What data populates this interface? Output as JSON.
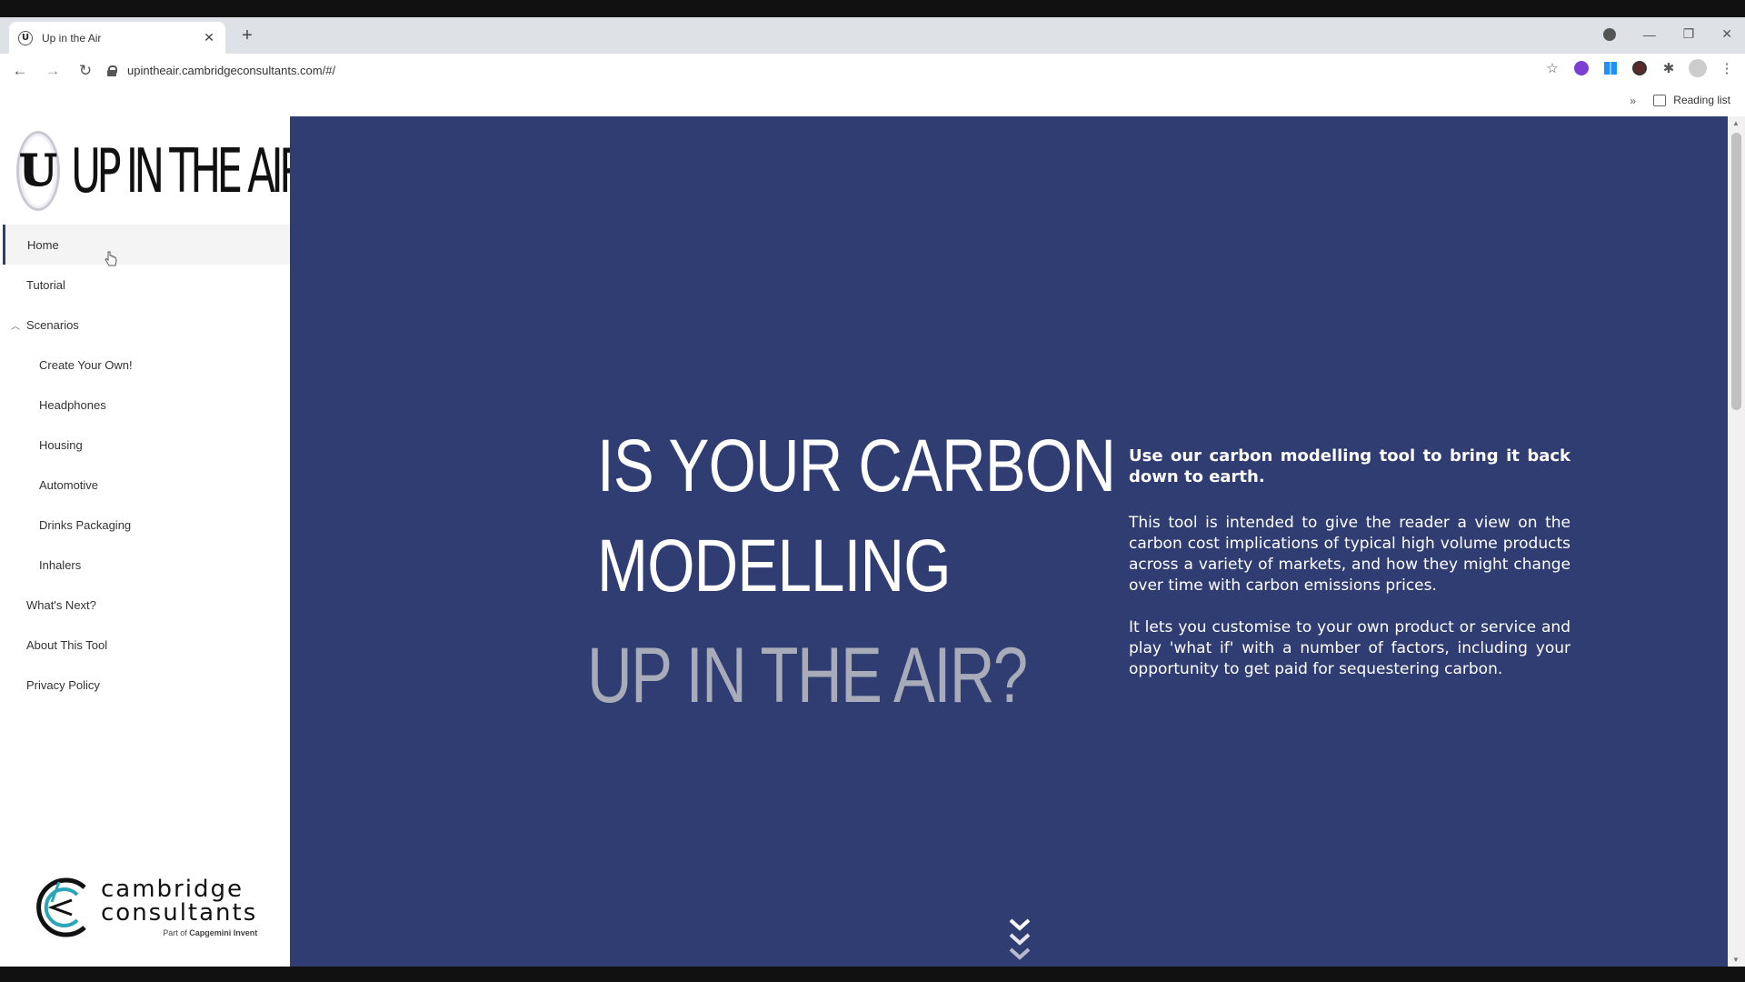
{
  "browser": {
    "tab_title": "Up in the Air",
    "tab_favicon_letter": "U",
    "url": "upintheair.cambridgeconsultants.com/#/",
    "reading_list_label": "Reading list"
  },
  "brand": {
    "badge_letter": "U",
    "name": "UP IN THE AIR"
  },
  "nav": {
    "items": [
      {
        "label": "Home",
        "active": true
      },
      {
        "label": "Tutorial"
      },
      {
        "label": "Scenarios",
        "group": true,
        "expanded": true
      },
      {
        "label": "Create Your Own!",
        "sub": true
      },
      {
        "label": "Headphones",
        "sub": true
      },
      {
        "label": "Housing",
        "sub": true
      },
      {
        "label": "Automotive",
        "sub": true
      },
      {
        "label": "Drinks Packaging",
        "sub": true
      },
      {
        "label": "Inhalers",
        "sub": true
      },
      {
        "label": "What's Next?"
      },
      {
        "label": "About This Tool"
      },
      {
        "label": "Privacy Policy"
      }
    ]
  },
  "footer_logo": {
    "line1": "cambridge",
    "line2": "consultants",
    "tagline_prefix": "Part of",
    "tagline_brand": "Capgemini Invent"
  },
  "hero": {
    "headline_line1": "IS YOUR CARBON",
    "headline_line2": "MODELLING",
    "headline_line3": "UP IN THE AIR?",
    "lead": "Use our carbon modelling tool to bring it back down to earth.",
    "para1": "This tool is intended to give the reader a view on the carbon cost implications of typical high volume products across a variety of markets, and how they might change over time with carbon emissions prices.",
    "para2": "It lets you customise to your own product or service and play 'what if' with a number of factors, including your opportunity to get paid for sequestering carbon."
  },
  "colors": {
    "hero_bg": "#2f3d73",
    "headline_grey": "#a8acb8",
    "active_border": "#2e3d75"
  }
}
